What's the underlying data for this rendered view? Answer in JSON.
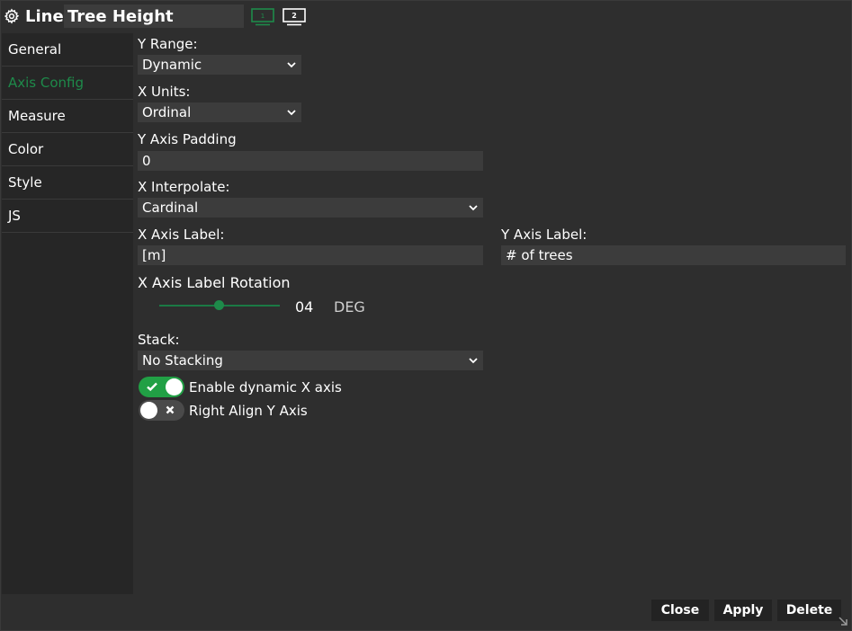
{
  "header": {
    "type_label": "Line",
    "title_value": "Tree Height",
    "screen_1_label": "1",
    "screen_2_label": "2"
  },
  "sidebar": {
    "items": [
      {
        "label": "General"
      },
      {
        "label": "Axis Config"
      },
      {
        "label": "Measure"
      },
      {
        "label": "Color"
      },
      {
        "label": "Style"
      },
      {
        "label": "JS"
      }
    ],
    "active": "Axis Config"
  },
  "form": {
    "y_range": {
      "label": "Y Range:",
      "value": "Dynamic"
    },
    "x_units": {
      "label": "X Units:",
      "value": "Ordinal"
    },
    "y_axis_padding": {
      "label": "Y Axis Padding",
      "value": "0"
    },
    "x_interpolate": {
      "label": "X Interpolate:",
      "value": "Cardinal"
    },
    "x_axis_label": {
      "label": "X Axis Label:",
      "value": "[m]"
    },
    "y_axis_label": {
      "label": "Y Axis Label:",
      "value": "# of trees"
    },
    "x_axis_label_rotation": {
      "label": "X Axis Label Rotation",
      "value": "04",
      "unit": "DEG"
    },
    "stack": {
      "label": "Stack:",
      "value": "No Stacking"
    },
    "enable_dynamic_x_axis": {
      "label": "Enable dynamic X axis",
      "checked": true
    },
    "right_align_y_axis": {
      "label": "Right Align Y Axis",
      "checked": false
    }
  },
  "footer": {
    "close_label": "Close",
    "apply_label": "Apply",
    "delete_label": "Delete"
  },
  "colors": {
    "accent": "#1e8a4a",
    "toggle_on": "#21a045",
    "background": "#2e2e2e",
    "sidebar": "#262626",
    "field": "#3c3c3c"
  },
  "icons": {
    "header": "gear-icon",
    "screens": [
      "monitor-1-icon",
      "monitor-2-icon"
    ],
    "select": "chevron-down-icon",
    "toggle_on": "check-icon",
    "toggle_off": "x-icon",
    "resize": "resize-handle-icon"
  }
}
